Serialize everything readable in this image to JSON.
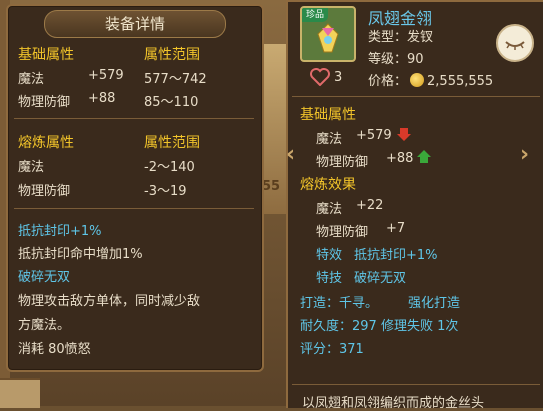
{
  "left_panel": {
    "title": "装备详情",
    "base_header": "基础属性",
    "range_header": "属性范围",
    "base_rows": [
      {
        "name": "魔法",
        "value": "+579",
        "range": "577～742"
      },
      {
        "name": "物理防御",
        "value": "+88",
        "range": "85～110"
      }
    ],
    "refine_header": "熔炼属性",
    "refine_range_header": "属性范围",
    "refine_rows": [
      {
        "name": "魔法",
        "range": "-2～140"
      },
      {
        "name": "物理防御",
        "range": "-3～19"
      }
    ],
    "effect1_name": "抵抗封印+1%",
    "effect1_desc": "抵抗封印命中增加1%",
    "effect2_name": "破碎无双",
    "effect2_desc_line1": "物理攻击敌方单体，同时减少敌",
    "effect2_desc_line2": "方魔法。",
    "effect2_cost": "消耗 80愤怒"
  },
  "right_panel": {
    "rare_badge": "珍品",
    "item_name": "凤翅金翎",
    "type_label": "类型：发钗",
    "level_label": "等级：90",
    "like_count": "3",
    "price_label": "价格：",
    "price_value": "2,555,555",
    "base_header": "基础属性",
    "base_rows": [
      {
        "name": "魔法",
        "value": "+579"
      },
      {
        "name": "物理防御",
        "value": "+88"
      }
    ],
    "refine_header": "熔炼效果",
    "refine_rows": [
      {
        "name": "魔法",
        "value": "+22"
      },
      {
        "name": "物理防御",
        "value": "+7"
      }
    ],
    "special_effect_label": "特效",
    "special_effect_value": "抵抗封印+1%",
    "special_skill_label": "特技",
    "special_skill_value": "破碎无双",
    "forge_label": "打造：千寻。",
    "forge_extra": "强化打造",
    "durability_line": "耐久度：297 修理失败 1次",
    "score_line": "评分：371",
    "description": "以凤翅和凤翎编织而成的金丝头"
  },
  "background": {
    "fragment_text": "55"
  },
  "colors": {
    "gold": "#f2c42a",
    "blue": "#5fc6e8",
    "text": "#e8ddc8",
    "panel": "#3a2a1c"
  }
}
